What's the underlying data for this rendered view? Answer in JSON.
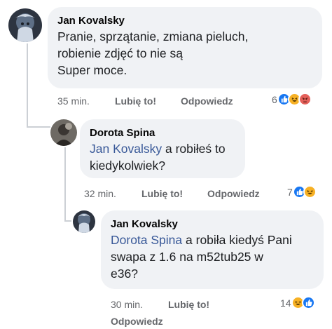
{
  "comments": [
    {
      "author": "Jan Kovalsky",
      "text_lines": [
        "Pranie, sprzątanie, zmiana pieluch,",
        "robienie zdjęć to nie są",
        "Super moce."
      ],
      "time": "35 min.",
      "like_label": "Lubię to!",
      "reply_label": "Odpowiedz",
      "reaction_count": "6",
      "reactions": [
        "like-icon",
        "haha-icon",
        "angry-icon"
      ]
    },
    {
      "author": "Dorota Spina",
      "mention": "Jan Kovalsky",
      "text_after_mention": " a robiłeś to",
      "text_line2": "kiedykolwiek?",
      "time": "32 min.",
      "like_label": "Lubię to!",
      "reply_label": "Odpowiedz",
      "reaction_count": "7",
      "reactions": [
        "like-icon",
        "haha-icon"
      ]
    },
    {
      "author": "Jan Kovalsky",
      "mention": "Dorota Spina",
      "text_after_mention": " a robiła kiedyś Pani",
      "text_line2": "swapa z 1.6 na m52tub25 w",
      "text_line3": "e36?",
      "time": "30 min.",
      "like_label": "Lubię to!",
      "reply_label": "Odpowiedz",
      "reaction_count": "14",
      "reactions": [
        "haha-icon",
        "like-icon"
      ]
    }
  ],
  "colors": {
    "bubble": "#f0f2f5",
    "mention": "#385898",
    "meta": "#65676b",
    "like": "#1877f2",
    "haha": "#f7b125",
    "angry": "#e4605a"
  }
}
